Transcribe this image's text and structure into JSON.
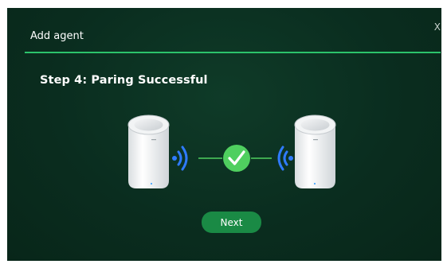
{
  "dialog": {
    "title": "Add agent",
    "close_label": "X",
    "step_text": "Step 4: Paring Successful",
    "next_label": "Next"
  },
  "icons": {
    "left_device": "mesh-router-icon",
    "left_signal": "wifi-signal-icon",
    "status": "check-icon",
    "right_signal": "wifi-signal-icon",
    "right_device": "mesh-router-icon"
  },
  "colors": {
    "background": "#0a2d1f",
    "accent": "#2cc36b",
    "button": "#1a8a45",
    "signal": "#2f7bff",
    "check": "#4fcf5f"
  }
}
